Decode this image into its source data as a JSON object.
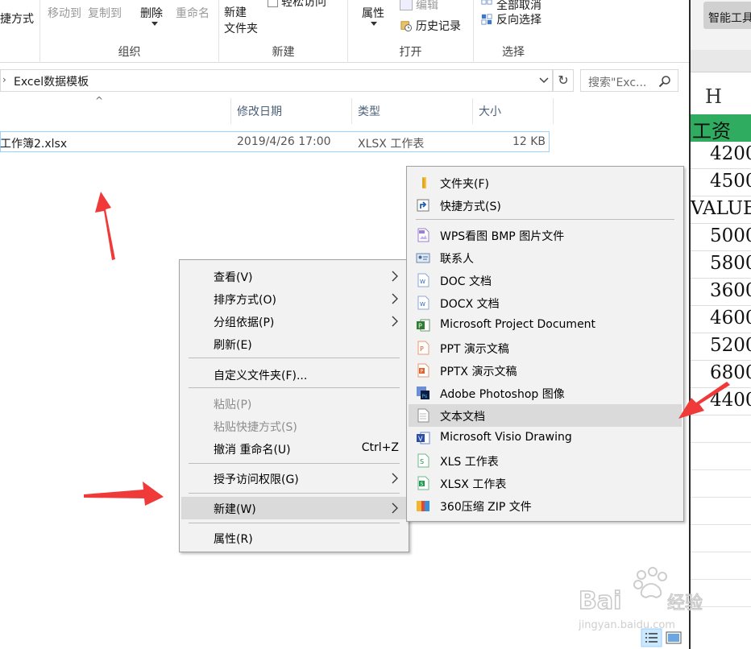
{
  "ribbon": {
    "partial_left": "捷方式",
    "move_to": "移动到",
    "copy_to": "复制到",
    "delete": "删除",
    "rename": "重命名",
    "group_organize": "组织",
    "new_folder": "新建\n文件夹",
    "easy_access": "轻松访问",
    "group_new": "新建",
    "properties": "属性",
    "edit": "编辑",
    "history": "历史记录",
    "group_open": "打开",
    "select_none": "全部取消",
    "invert_selection": "反向选择",
    "group_select": "选择"
  },
  "address_bar": {
    "path": "Excel数据模板",
    "search_placeholder": "搜索\"Exc..."
  },
  "columns": {
    "modified": "修改日期",
    "type": "类型",
    "size": "大小"
  },
  "file": {
    "name": "工作簿2.xlsx",
    "modified": "2019/4/26 17:00",
    "type": "XLSX 工作表",
    "size": "12 KB"
  },
  "spreadsheet": {
    "tool_label": "智能工具",
    "column_letter": "H",
    "header": "工资",
    "values": [
      "4200",
      "4500",
      "VALUE!",
      "5000",
      "5800",
      "3600",
      "4600",
      "5200",
      "6800",
      "4400"
    ]
  },
  "context_menu": {
    "view": "查看(V)",
    "sort": "排序方式(O)",
    "group_by": "分组依据(P)",
    "refresh": "刷新(E)",
    "customize": "自定义文件夹(F)...",
    "paste": "粘贴(P)",
    "paste_shortcut": "粘贴快捷方式(S)",
    "undo_rename": "撤消 重命名(U)",
    "undo_shortcut": "Ctrl+Z",
    "grant_access": "授予访问权限(G)",
    "new": "新建(W)",
    "properties": "属性(R)"
  },
  "new_submenu": [
    {
      "label": "文件夹(F)",
      "icon": "folder-icon"
    },
    {
      "label": "快捷方式(S)",
      "icon": "shortcut-icon"
    },
    {
      "label": "WPS看图 BMP 图片文件",
      "icon": "bmp-icon"
    },
    {
      "label": "联系人",
      "icon": "contact-icon"
    },
    {
      "label": "DOC 文档",
      "icon": "doc-icon"
    },
    {
      "label": "DOCX 文档",
      "icon": "docx-icon"
    },
    {
      "label": "Microsoft Project Document",
      "icon": "project-icon"
    },
    {
      "label": "PPT 演示文稿",
      "icon": "ppt-icon"
    },
    {
      "label": "PPTX 演示文稿",
      "icon": "pptx-icon"
    },
    {
      "label": "Adobe Photoshop 图像",
      "icon": "photoshop-icon"
    },
    {
      "label": "文本文档",
      "icon": "text-document-icon"
    },
    {
      "label": "Microsoft Visio Drawing",
      "icon": "visio-icon"
    },
    {
      "label": "XLS 工作表",
      "icon": "xls-icon"
    },
    {
      "label": "XLSX 工作表",
      "icon": "xlsx-icon"
    },
    {
      "label": "360压缩 ZIP 文件",
      "icon": "zip-icon"
    }
  ],
  "colors": {
    "accent_highlight": "#dadada",
    "annotation_arrow": "#f03a3a",
    "sheet_header_green": "#2fac5f",
    "selection_border": "#99d1ff"
  }
}
